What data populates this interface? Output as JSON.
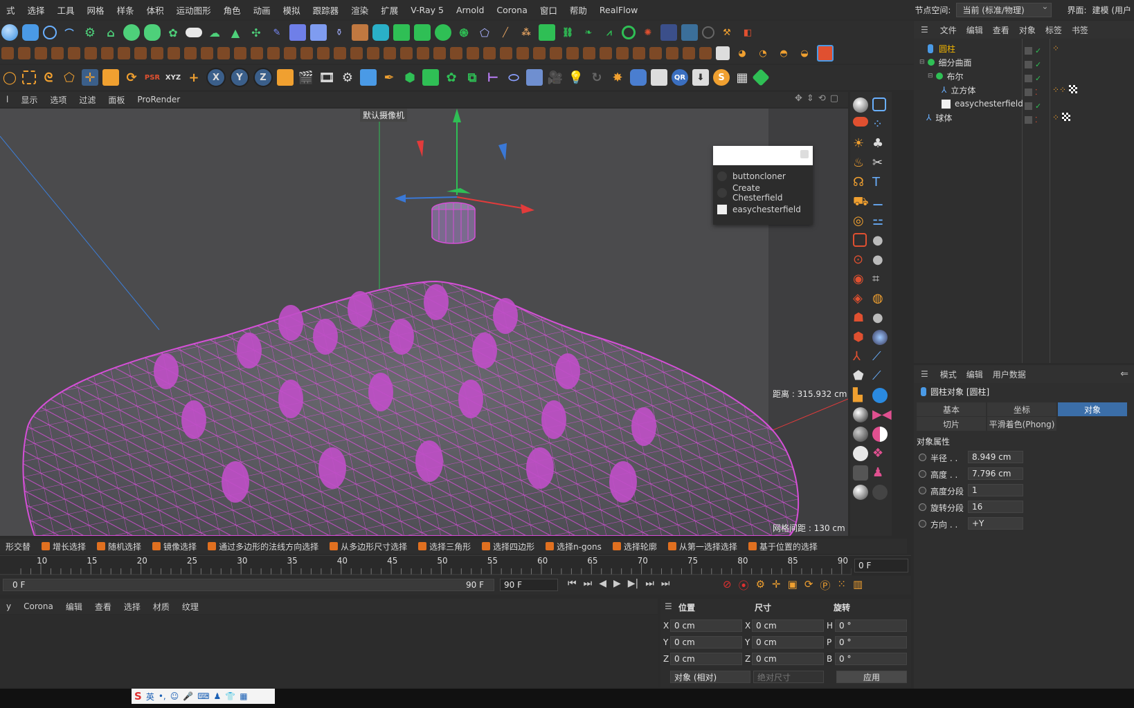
{
  "menubar": {
    "items": [
      "式",
      "选择",
      "工具",
      "网格",
      "样条",
      "体积",
      "运动图形",
      "角色",
      "动画",
      "模拟",
      "跟踪器",
      "渲染",
      "扩展",
      "V-Ray 5",
      "Arnold",
      "Corona",
      "窗口",
      "帮助",
      "RealFlow"
    ],
    "node_space_label": "节点空间:",
    "node_space_value": "当前 (标准/物理)",
    "layout_label": "界面:",
    "layout_value": "建模 (用户"
  },
  "viewport_menu": {
    "items": [
      "l",
      "显示",
      "选项",
      "过滤",
      "面板",
      "ProRender"
    ]
  },
  "viewport": {
    "camera_label": "默认摄像机",
    "distance_text": "距离 : 315.932 cm",
    "grid_text": "网格间距 : 130 cm",
    "colors": {
      "bg": "#4a4a4c",
      "wire": "#d64fd8",
      "axis_y": "#2fbf55",
      "axis_x": "#e23b3b",
      "axis_z": "#3a78d6"
    }
  },
  "popup": {
    "items": [
      {
        "label": "buttoncloner",
        "icon": "cloner-icon"
      },
      {
        "label": "Create Chesterfield",
        "icon": "script-icon"
      },
      {
        "label": "easychesterfield",
        "icon": "white-box-icon"
      }
    ]
  },
  "object_manager": {
    "menu": [
      "文件",
      "编辑",
      "查看",
      "对象",
      "标签",
      "书签"
    ],
    "rows": [
      {
        "name": "圆柱",
        "indent": 0,
        "color": "#f0b400",
        "icon": "cylinder-icon"
      },
      {
        "name": "细分曲面",
        "indent": 0,
        "color": "#e8e8e8",
        "icon": "subdivision-icon"
      },
      {
        "name": "布尔",
        "indent": 1,
        "color": "#e8e8e8",
        "icon": "boole-icon"
      },
      {
        "name": "立方体",
        "indent": 2,
        "color": "#e8e8e8",
        "icon": "cube-icon"
      },
      {
        "name": "easychesterfield",
        "indent": 2,
        "color": "#e8e8e8",
        "icon": "white-box-icon"
      },
      {
        "name": "球体",
        "indent": 0,
        "color": "#e8e8e8",
        "icon": "sphere-icon"
      }
    ]
  },
  "attribute_manager": {
    "menu": [
      "模式",
      "编辑",
      "用户数据"
    ],
    "title": "圆柱对象 [圆柱]",
    "tabs": [
      "基本",
      "坐标",
      "对象",
      "切片",
      "平滑着色(Phong)"
    ],
    "active_tab": "对象",
    "section": "对象属性",
    "fields": [
      {
        "label": "半径",
        "dots": " . .",
        "value": "8.949 cm"
      },
      {
        "label": "高度",
        "dots": " . .",
        "value": "7.796 cm"
      },
      {
        "label": "高度分段",
        "dots": "",
        "value": "1"
      },
      {
        "label": "旋转分段",
        "dots": "",
        "value": "16"
      },
      {
        "label": "方向",
        "dots": " . .",
        "value": "+Y"
      }
    ]
  },
  "selection_bar": {
    "items": [
      {
        "label": "形交替",
        "color": "#888"
      },
      {
        "label": "增长选择",
        "color": "#e07020"
      },
      {
        "label": "随机选择",
        "color": "#e07020"
      },
      {
        "label": "镜像选择",
        "color": "#e07020"
      },
      {
        "label": "通过多边形的法线方向选择",
        "color": "#e07020"
      },
      {
        "label": "从多边形尺寸选择",
        "color": "#e07020"
      },
      {
        "label": "选择三角形",
        "color": "#e07020"
      },
      {
        "label": "选择四边形",
        "color": "#e07020"
      },
      {
        "label": "选择n-gons",
        "color": "#e07020"
      },
      {
        "label": "选择轮廓",
        "color": "#e07020"
      },
      {
        "label": "从第一选择选择",
        "color": "#e07020"
      },
      {
        "label": "基于位置的选择",
        "color": "#e07020"
      }
    ]
  },
  "timeline": {
    "ticks": [
      "10",
      "15",
      "20",
      "25",
      "30",
      "35",
      "40",
      "45",
      "50",
      "55",
      "60",
      "65",
      "70",
      "75",
      "80",
      "85",
      "90"
    ],
    "current_frame": "0 F",
    "start": "0 F",
    "end_in_bar": "90 F",
    "end_field": "90 F"
  },
  "material_menu": {
    "items": [
      "y",
      "Corona",
      "编辑",
      "查看",
      "选择",
      "材质",
      "纹理"
    ]
  },
  "coordinates": {
    "headers": [
      "位置",
      "尺寸",
      "旋转"
    ],
    "rows": [
      {
        "a": "X",
        "pos": "0 cm",
        "b": "X",
        "size": "0 cm",
        "c": "H",
        "rot": "0 °"
      },
      {
        "a": "Y",
        "pos": "0 cm",
        "b": "Y",
        "size": "0 cm",
        "c": "P",
        "rot": "0 °"
      },
      {
        "a": "Z",
        "pos": "0 cm",
        "b": "Z",
        "size": "0 cm",
        "c": "B",
        "rot": "0 °"
      }
    ],
    "mode": "对象 (相对)",
    "size_mode": "绝对尺寸",
    "apply": "应用"
  },
  "taskbar": {
    "ime_label": "英"
  }
}
